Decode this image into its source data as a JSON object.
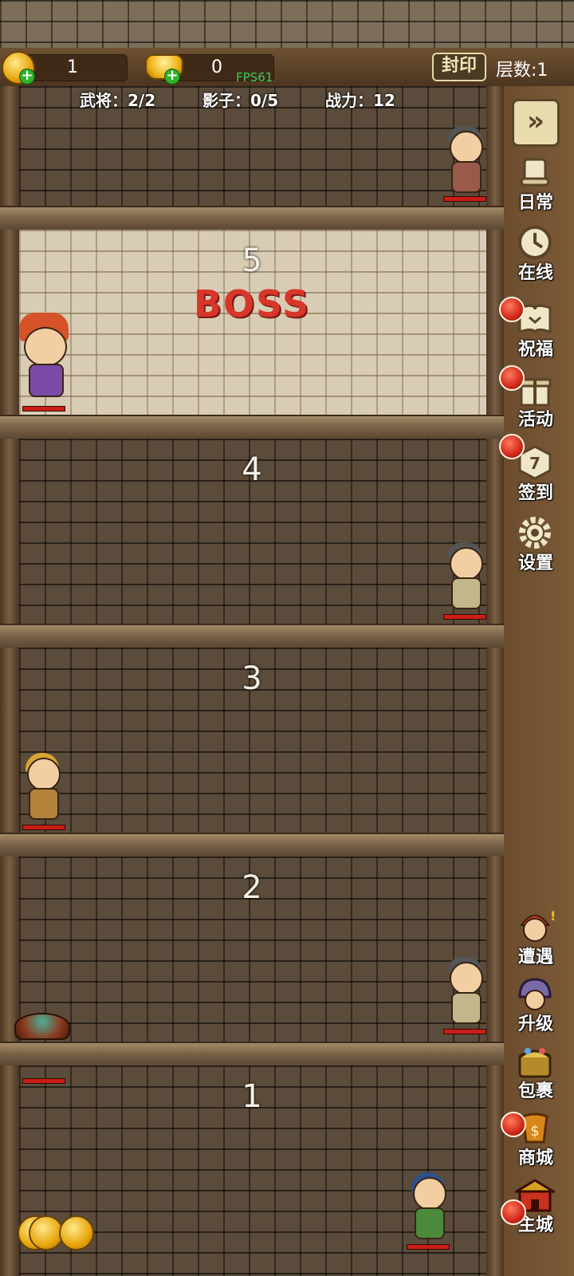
{
  "resources": {
    "coins": "1",
    "ingots": "0",
    "fps": "FPS61",
    "seal_label": "封印",
    "floor_label": "层数:1"
  },
  "stats": {
    "generals": "武将：2/2",
    "shadows": "影子：0/5",
    "power": "战力：12"
  },
  "floors": [
    {
      "number": "5",
      "boss": "BOSS"
    },
    {
      "number": "4"
    },
    {
      "number": "3"
    },
    {
      "number": "2"
    },
    {
      "number": "1"
    }
  ],
  "sidebar_top": [
    {
      "label": "日常",
      "icon": "scroll-icon",
      "badge": false
    },
    {
      "label": "在线",
      "icon": "clock-icon",
      "badge": false
    },
    {
      "label": "祝福",
      "icon": "book-icon",
      "badge": true
    },
    {
      "label": "活动",
      "icon": "gift-icon",
      "badge": true
    },
    {
      "label": "签到",
      "icon": "checkin-7-icon",
      "badge": true
    },
    {
      "label": "设置",
      "icon": "gear-icon",
      "badge": false
    }
  ],
  "sidebar_bottom": [
    {
      "label": "遭遇",
      "icon": "encounter-icon",
      "badge": false
    },
    {
      "label": "升级",
      "icon": "helmet-icon",
      "badge": false
    },
    {
      "label": "包裹",
      "icon": "chest-icon",
      "badge": false
    },
    {
      "label": "商城",
      "icon": "shop-icon",
      "badge": true
    },
    {
      "label": "主城",
      "icon": "castle-icon",
      "badge": true
    }
  ],
  "colors": {
    "boss_text": "#d8362a",
    "hp_bar": "#c81e14",
    "badge": "#d0281a",
    "fps_text": "#3ecc5a"
  }
}
